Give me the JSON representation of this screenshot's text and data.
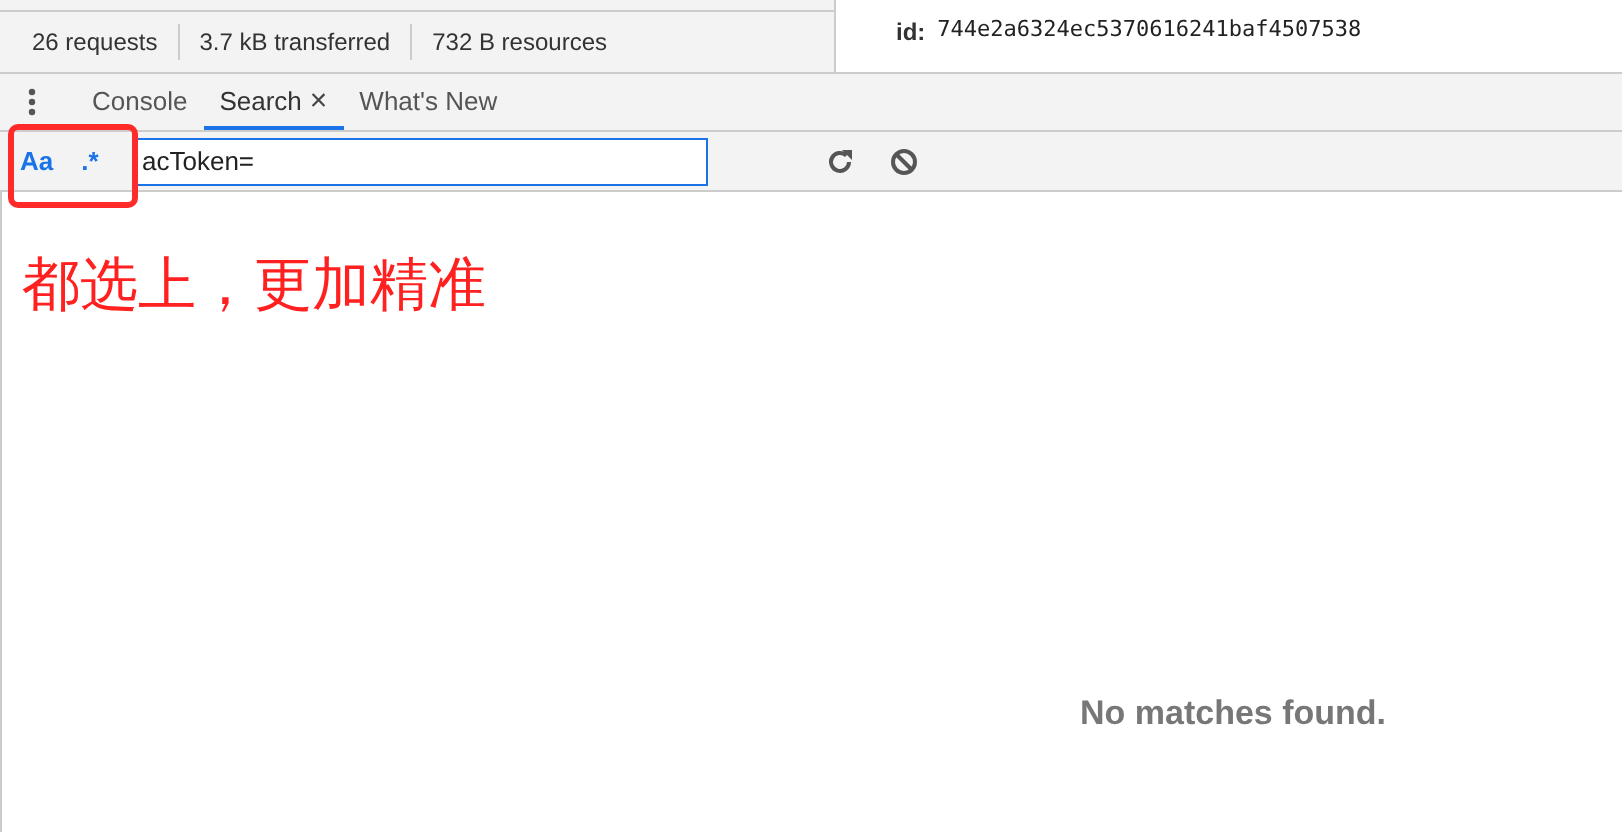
{
  "network_summary": [
    "26 requests",
    "3.7 kB transferred",
    "732 B resources"
  ],
  "detail": {
    "label": "id:",
    "value": "744e2a6324ec5370616241baf4507538"
  },
  "tabs": [
    {
      "label": "Console",
      "selected": false
    },
    {
      "label": "Search",
      "selected": true,
      "close": "×"
    },
    {
      "label": "What's New",
      "selected": false
    }
  ],
  "search": {
    "toggles": [
      {
        "label": "Aa",
        "on": true
      },
      {
        "label": ".*",
        "on": true
      }
    ],
    "value": "acToken="
  },
  "annotation": "都选上，更加精准",
  "result_message": "No matches found."
}
